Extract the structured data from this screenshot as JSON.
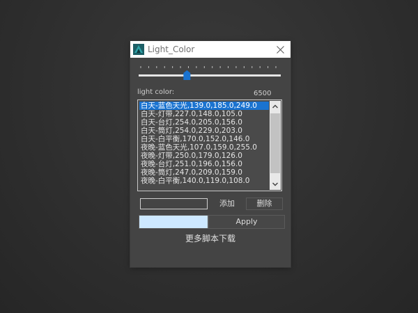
{
  "window": {
    "title": "Light_Color",
    "close_icon": "close-icon"
  },
  "slider": {
    "value_fraction": 0.34,
    "tick_count": 18,
    "accent": "#1a73d0"
  },
  "light": {
    "label": "light color:",
    "value": "6500"
  },
  "presets": [
    "白天-蓝色天光,139.0,185.0,249.0",
    "白天-灯带,227.0,148.0,105.0",
    "白天-台灯,254.0,205.0,156.0",
    "白天-筒灯,254.0,229.0,203.0",
    "白天-白平衡,170.0,152.0,146.0",
    "夜晚-蓝色天光,107.0,159.0,255.0",
    "夜晚-灯带,250.0,179.0,126.0",
    "夜晚-台灯,251.0,196.0,156.0",
    "夜晚-筒灯,247.0,209.0,159.0",
    "夜晚-白平衡,140.0,119.0,108.0"
  ],
  "selected_index": 0,
  "name_input": {
    "value": "",
    "placeholder": ""
  },
  "buttons": {
    "add": "添加",
    "delete": "删除",
    "apply": "Apply"
  },
  "swatch_color": "#cde8ff",
  "more_link": "更多脚本下载"
}
